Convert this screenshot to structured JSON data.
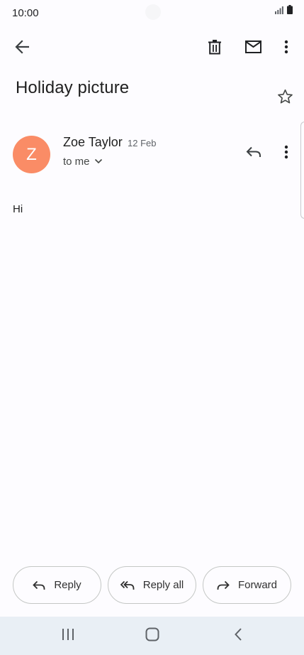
{
  "status_bar": {
    "time": "10:00",
    "icons": [
      "signal-icon",
      "battery-icon"
    ]
  },
  "toolbar": {
    "icons": [
      "back-arrow-icon",
      "delete-icon",
      "mark-unread-icon",
      "more-vert-icon"
    ]
  },
  "email": {
    "subject": "Holiday picture",
    "sender": {
      "initial": "Z",
      "name": "Zoe Taylor",
      "date": "12 Feb",
      "recipient_label": "to me",
      "avatar_color": "#fa8c66"
    },
    "body": "Hi"
  },
  "actions": {
    "reply_label": "Reply",
    "reply_all_label": "Reply all",
    "forward_label": "Forward"
  },
  "nav_bar": {
    "icons": [
      "recent-apps-icon",
      "home-icon",
      "nav-back-icon"
    ]
  }
}
